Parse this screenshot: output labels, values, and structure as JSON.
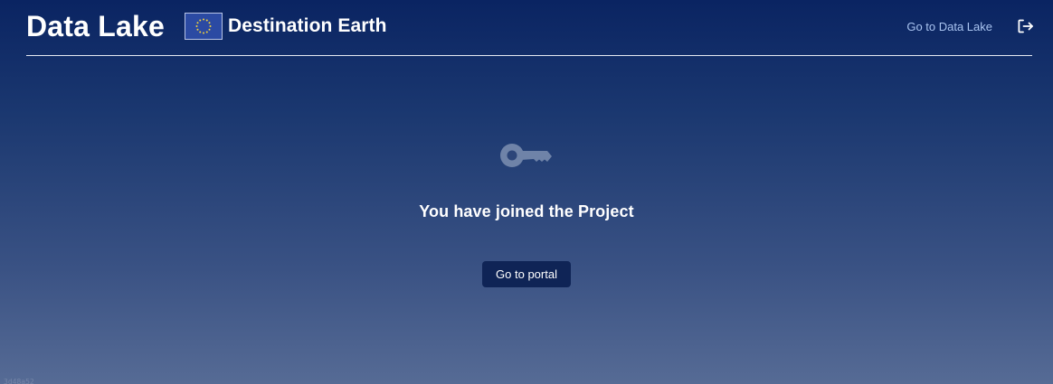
{
  "header": {
    "app_title": "Data Lake",
    "brand": "Destination Earth",
    "nav_link": "Go to Data Lake",
    "icons": {
      "flag": "eu-flag-icon",
      "logout": "logout-icon"
    }
  },
  "main": {
    "icon": "key-icon",
    "message": "You have joined the Project",
    "button_label": "Go to portal"
  },
  "footer": {
    "version": "3d48a52"
  },
  "colors": {
    "background_top": "#0a2462",
    "background_bottom": "#566b95",
    "button": "#0f2456",
    "link": "#a9c4f0",
    "key_icon": "#6f83a8"
  }
}
